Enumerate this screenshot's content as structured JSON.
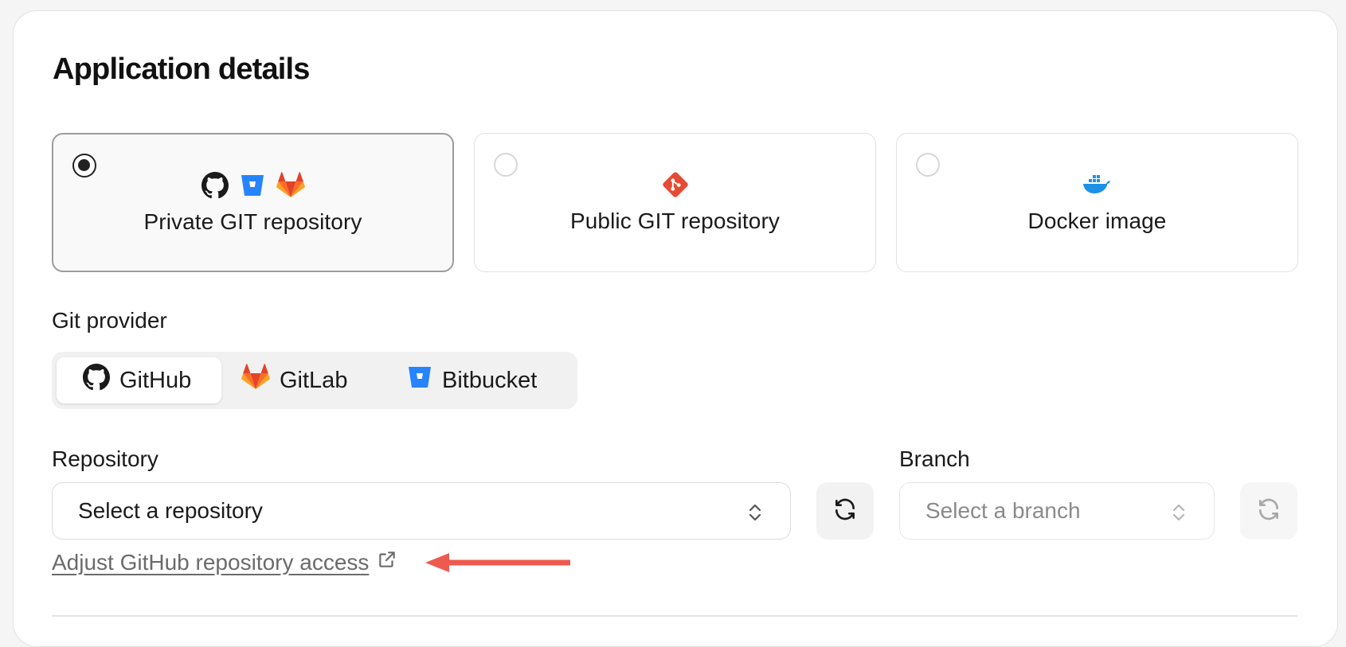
{
  "section_title": "Application details",
  "sources": [
    {
      "label": "Private GIT repository",
      "selected": true,
      "icons": [
        "github-icon",
        "bitbucket-icon",
        "gitlab-icon"
      ]
    },
    {
      "label": "Public GIT repository",
      "selected": false,
      "icons": [
        "git-icon"
      ]
    },
    {
      "label": "Docker image",
      "selected": false,
      "icons": [
        "docker-icon"
      ]
    }
  ],
  "git_provider": {
    "label": "Git provider",
    "options": [
      {
        "label": "GitHub",
        "icon": "github-icon",
        "active": true
      },
      {
        "label": "GitLab",
        "icon": "gitlab-icon",
        "active": false
      },
      {
        "label": "Bitbucket",
        "icon": "bitbucket-icon",
        "active": false
      }
    ]
  },
  "repository": {
    "label": "Repository",
    "placeholder": "Select a repository"
  },
  "branch": {
    "label": "Branch",
    "placeholder": "Select a branch"
  },
  "access_link": {
    "label": "Adjust GitHub repository access"
  },
  "colors": {
    "annotation_arrow": "#ee5a4f",
    "gitlab": "#fc6d26",
    "bitbucket": "#2684ff",
    "git": "#e64a33",
    "docker": "#1d91e6"
  }
}
